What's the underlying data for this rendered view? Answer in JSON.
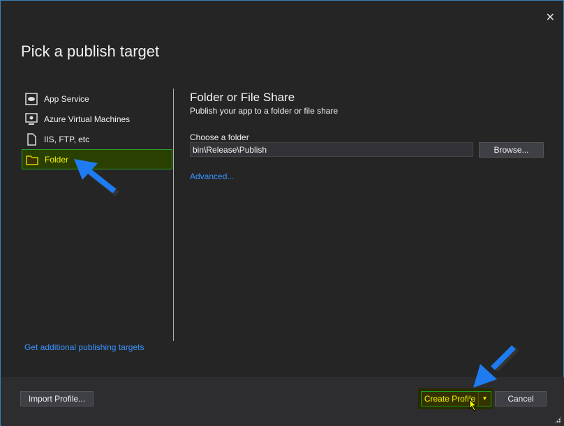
{
  "dialog": {
    "title": "Pick a publish target",
    "close_icon": "close-icon"
  },
  "targets": [
    {
      "label": "App Service",
      "icon": "app-service-icon"
    },
    {
      "label": "Azure Virtual Machines",
      "icon": "virtual-machine-icon"
    },
    {
      "label": "IIS, FTP, etc",
      "icon": "document-icon"
    },
    {
      "label": "Folder",
      "icon": "folder-icon",
      "selected": true
    }
  ],
  "more_targets_link": "Get additional publishing targets",
  "detail": {
    "heading": "Folder or File Share",
    "description": "Publish your app to a folder or file share",
    "folder_label": "Choose a folder",
    "folder_value": "bin\\Release\\Publish",
    "browse_label": "Browse...",
    "advanced_link": "Advanced..."
  },
  "footer": {
    "import_label": "Import Profile...",
    "create_label": "Create Profile",
    "cancel_label": "Cancel"
  },
  "colors": {
    "accent_link": "#3794ff",
    "highlight_text": "#f6f600",
    "highlight_border": "#2ea02e",
    "annotation_arrow": "#1e7cf0"
  }
}
